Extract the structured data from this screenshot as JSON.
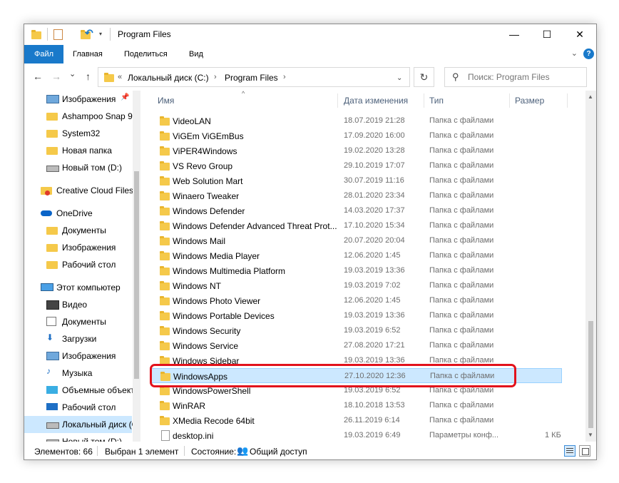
{
  "window": {
    "title": "Program Files",
    "controls": {
      "minimize": "—",
      "maximize": "☐",
      "close": "✕"
    }
  },
  "ribbon": {
    "tabs": [
      "Файл",
      "Главная",
      "Поделиться",
      "Вид"
    ],
    "collapse_icon": "chevron-down-icon",
    "help": "?"
  },
  "nav": {
    "back": "←",
    "forward": "→",
    "recent": "⌄",
    "up": "↑",
    "breadcrumb": [
      "Локальный диск (C:)",
      "Program Files"
    ],
    "breadcrumb_prefix": "«",
    "refresh": "↻",
    "search_placeholder": "Поиск: Program Files"
  },
  "navpane": {
    "items": [
      {
        "label": "Изображения",
        "icon": "pictures-icon",
        "pinned": true
      },
      {
        "label": "Ashampoo Snap 9",
        "icon": "folder-icon"
      },
      {
        "label": "System32",
        "icon": "folder-icon"
      },
      {
        "label": "Новая папка",
        "icon": "folder-icon"
      },
      {
        "label": "Новый том (D:)",
        "icon": "drive-icon"
      },
      {
        "label": "Creative Cloud Files",
        "icon": "creative-cloud-icon"
      },
      {
        "label": "OneDrive",
        "icon": "onedrive-icon"
      },
      {
        "label": "Документы",
        "icon": "folder-icon"
      },
      {
        "label": "Изображения",
        "icon": "folder-icon"
      },
      {
        "label": "Рабочий стол",
        "icon": "folder-icon"
      },
      {
        "label": "Этот компьютер",
        "icon": "computer-icon"
      },
      {
        "label": "Видео",
        "icon": "video-icon"
      },
      {
        "label": "Документы",
        "icon": "documents-icon"
      },
      {
        "label": "Загрузки",
        "icon": "downloads-icon"
      },
      {
        "label": "Изображения",
        "icon": "pictures-icon"
      },
      {
        "label": "Музыка",
        "icon": "music-icon"
      },
      {
        "label": "Объемные объекты",
        "icon": "3d-objects-icon"
      },
      {
        "label": "Рабочий стол",
        "icon": "desktop-icon"
      },
      {
        "label": "Локальный диск (C:)",
        "icon": "drive-icon",
        "selected": true
      },
      {
        "label": "Новый том (D:)",
        "icon": "drive-icon"
      }
    ]
  },
  "columns": {
    "name": "Имя",
    "date": "Дата изменения",
    "type": "Тип",
    "size": "Размер"
  },
  "files": [
    {
      "name": "VideoLAN",
      "date": "18.07.2019 21:28",
      "type": "Папка с файлами",
      "size": ""
    },
    {
      "name": "ViGEm ViGEmBus",
      "date": "17.09.2020 16:00",
      "type": "Папка с файлами",
      "size": ""
    },
    {
      "name": "ViPER4Windows",
      "date": "19.02.2020 13:28",
      "type": "Папка с файлами",
      "size": ""
    },
    {
      "name": "VS Revo Group",
      "date": "29.10.2019 17:07",
      "type": "Папка с файлами",
      "size": ""
    },
    {
      "name": "Web Solution Mart",
      "date": "30.07.2019 11:16",
      "type": "Папка с файлами",
      "size": ""
    },
    {
      "name": "Winaero Tweaker",
      "date": "28.01.2020 23:34",
      "type": "Папка с файлами",
      "size": ""
    },
    {
      "name": "Windows Defender",
      "date": "14.03.2020 17:37",
      "type": "Папка с файлами",
      "size": ""
    },
    {
      "name": "Windows Defender Advanced Threat Prot...",
      "date": "17.10.2020 15:34",
      "type": "Папка с файлами",
      "size": ""
    },
    {
      "name": "Windows Mail",
      "date": "20.07.2020 20:04",
      "type": "Папка с файлами",
      "size": ""
    },
    {
      "name": "Windows Media Player",
      "date": "12.06.2020 1:45",
      "type": "Папка с файлами",
      "size": ""
    },
    {
      "name": "Windows Multimedia Platform",
      "date": "19.03.2019 13:36",
      "type": "Папка с файлами",
      "size": ""
    },
    {
      "name": "Windows NT",
      "date": "19.03.2019 7:02",
      "type": "Папка с файлами",
      "size": ""
    },
    {
      "name": "Windows Photo Viewer",
      "date": "12.06.2020 1:45",
      "type": "Папка с файлами",
      "size": ""
    },
    {
      "name": "Windows Portable Devices",
      "date": "19.03.2019 13:36",
      "type": "Папка с файлами",
      "size": ""
    },
    {
      "name": "Windows Security",
      "date": "19.03.2019 6:52",
      "type": "Папка с файлами",
      "size": ""
    },
    {
      "name": "Windows Service",
      "date": "27.08.2020 17:21",
      "type": "Папка с файлами",
      "size": ""
    },
    {
      "name": "Windows Sidebar",
      "date": "19.03.2019 13:36",
      "type": "Папка с файлами",
      "size": ""
    },
    {
      "name": "WindowsApps",
      "date": "27.10.2020 12:36",
      "type": "Папка с файлами",
      "size": "",
      "selected": true
    },
    {
      "name": "WindowsPowerShell",
      "date": "19.03.2019 6:52",
      "type": "Папка с файлами",
      "size": ""
    },
    {
      "name": "WinRAR",
      "date": "18.10.2018 13:53",
      "type": "Папка с файлами",
      "size": ""
    },
    {
      "name": "XMedia Recode 64bit",
      "date": "26.11.2019 6:14",
      "type": "Папка с файлами",
      "size": ""
    },
    {
      "name": "desktop.ini",
      "date": "19.03.2019 6:49",
      "type": "Параметры конф...",
      "size": "1 КБ",
      "file": true
    }
  ],
  "status": {
    "count": "Элементов: 66",
    "selected": "Выбран 1 элемент",
    "state_label": "Состояние:",
    "state_value": "Общий доступ"
  },
  "colors": {
    "accent": "#1979ca",
    "selection": "#cce8ff",
    "highlight_frame": "#e2121c",
    "folder": "#f5c94a"
  }
}
